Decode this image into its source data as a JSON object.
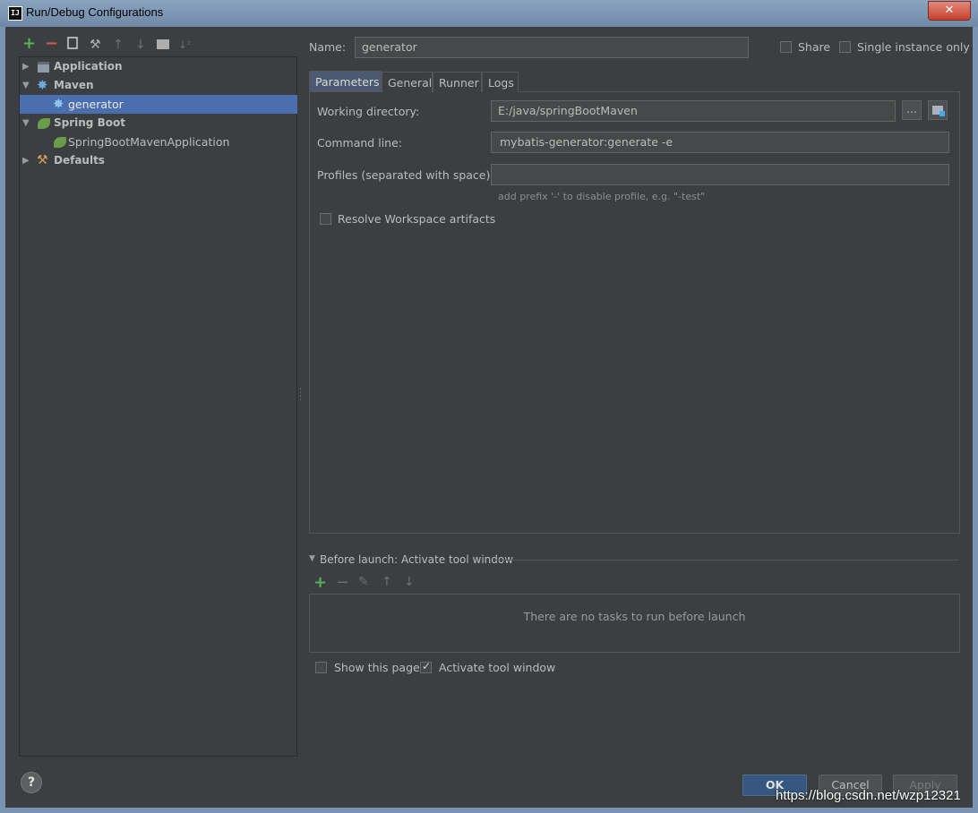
{
  "window": {
    "title": "Run/Debug Configurations",
    "app_icon": "IJ",
    "close_glyph": "✕"
  },
  "toolbar": {
    "icons": [
      "add-icon",
      "remove-icon",
      "copy-icon",
      "wrench-icon",
      "move-up-icon",
      "move-down-icon",
      "folder-icon",
      "sort-icon"
    ],
    "add": "+",
    "remove": "−",
    "up": "↑",
    "down": "↓",
    "sort": "↓ᶻ",
    "wrench": "⚒"
  },
  "tree": {
    "items": [
      {
        "label": "Application",
        "icon": "application-icon",
        "expanded": false
      },
      {
        "label": "Maven",
        "icon": "maven-gear-icon",
        "expanded": true
      },
      {
        "label": "generator",
        "icon": "maven-gear-icon",
        "selected": true
      },
      {
        "label": "Spring Boot",
        "icon": "spring-boot-icon",
        "expanded": true
      },
      {
        "label": "SpringBootMavenApplication",
        "icon": "spring-boot-icon"
      },
      {
        "label": "Defaults",
        "icon": "defaults-wrench-icon",
        "expanded": false
      }
    ],
    "collapsed_arrow": "▶",
    "expanded_arrow": "▼",
    "gear": "✸",
    "wrench": "⚒"
  },
  "form": {
    "name_label": "Name:",
    "name_value": "generator",
    "share_label": "Share",
    "single_instance_label": "Single instance only"
  },
  "tabs": [
    "Parameters",
    "General",
    "Runner",
    "Logs"
  ],
  "parameters": {
    "working_directory_label": "Working directory:",
    "working_directory_value": "E:/java/springBootMaven",
    "browse_label": "...",
    "command_line_label": "Command line:",
    "command_line_value": "mybatis-generator:generate -e",
    "profiles_label": "Profiles (separated with space):",
    "profiles_value": "",
    "profiles_hint": "add prefix '-' to disable profile, e.g. \"-test\"",
    "resolve_workspace_label": "Resolve Workspace artifacts"
  },
  "before_launch": {
    "title": "Before launch: Activate tool window",
    "toggle_arrow": "▼",
    "empty_text": "There are no tasks to run before launch",
    "add": "+",
    "remove": "−",
    "edit": "✎",
    "up": "↑",
    "down": "↓"
  },
  "options": {
    "show_this_page_label": "Show this page",
    "show_this_page_checked": false,
    "activate_tool_window_label": "Activate tool window",
    "activate_tool_window_checked": true
  },
  "buttons": {
    "ok": "OK",
    "cancel": "Cancel",
    "apply": "Apply",
    "help": "?"
  },
  "watermark": "https://blog.csdn.net/wzp12321",
  "colors": {
    "background": "#3c3f41",
    "selection": "#4b6eaf",
    "ok_button": "#365880",
    "add_green": "#5aad5a",
    "remove_red": "#d9534f"
  }
}
